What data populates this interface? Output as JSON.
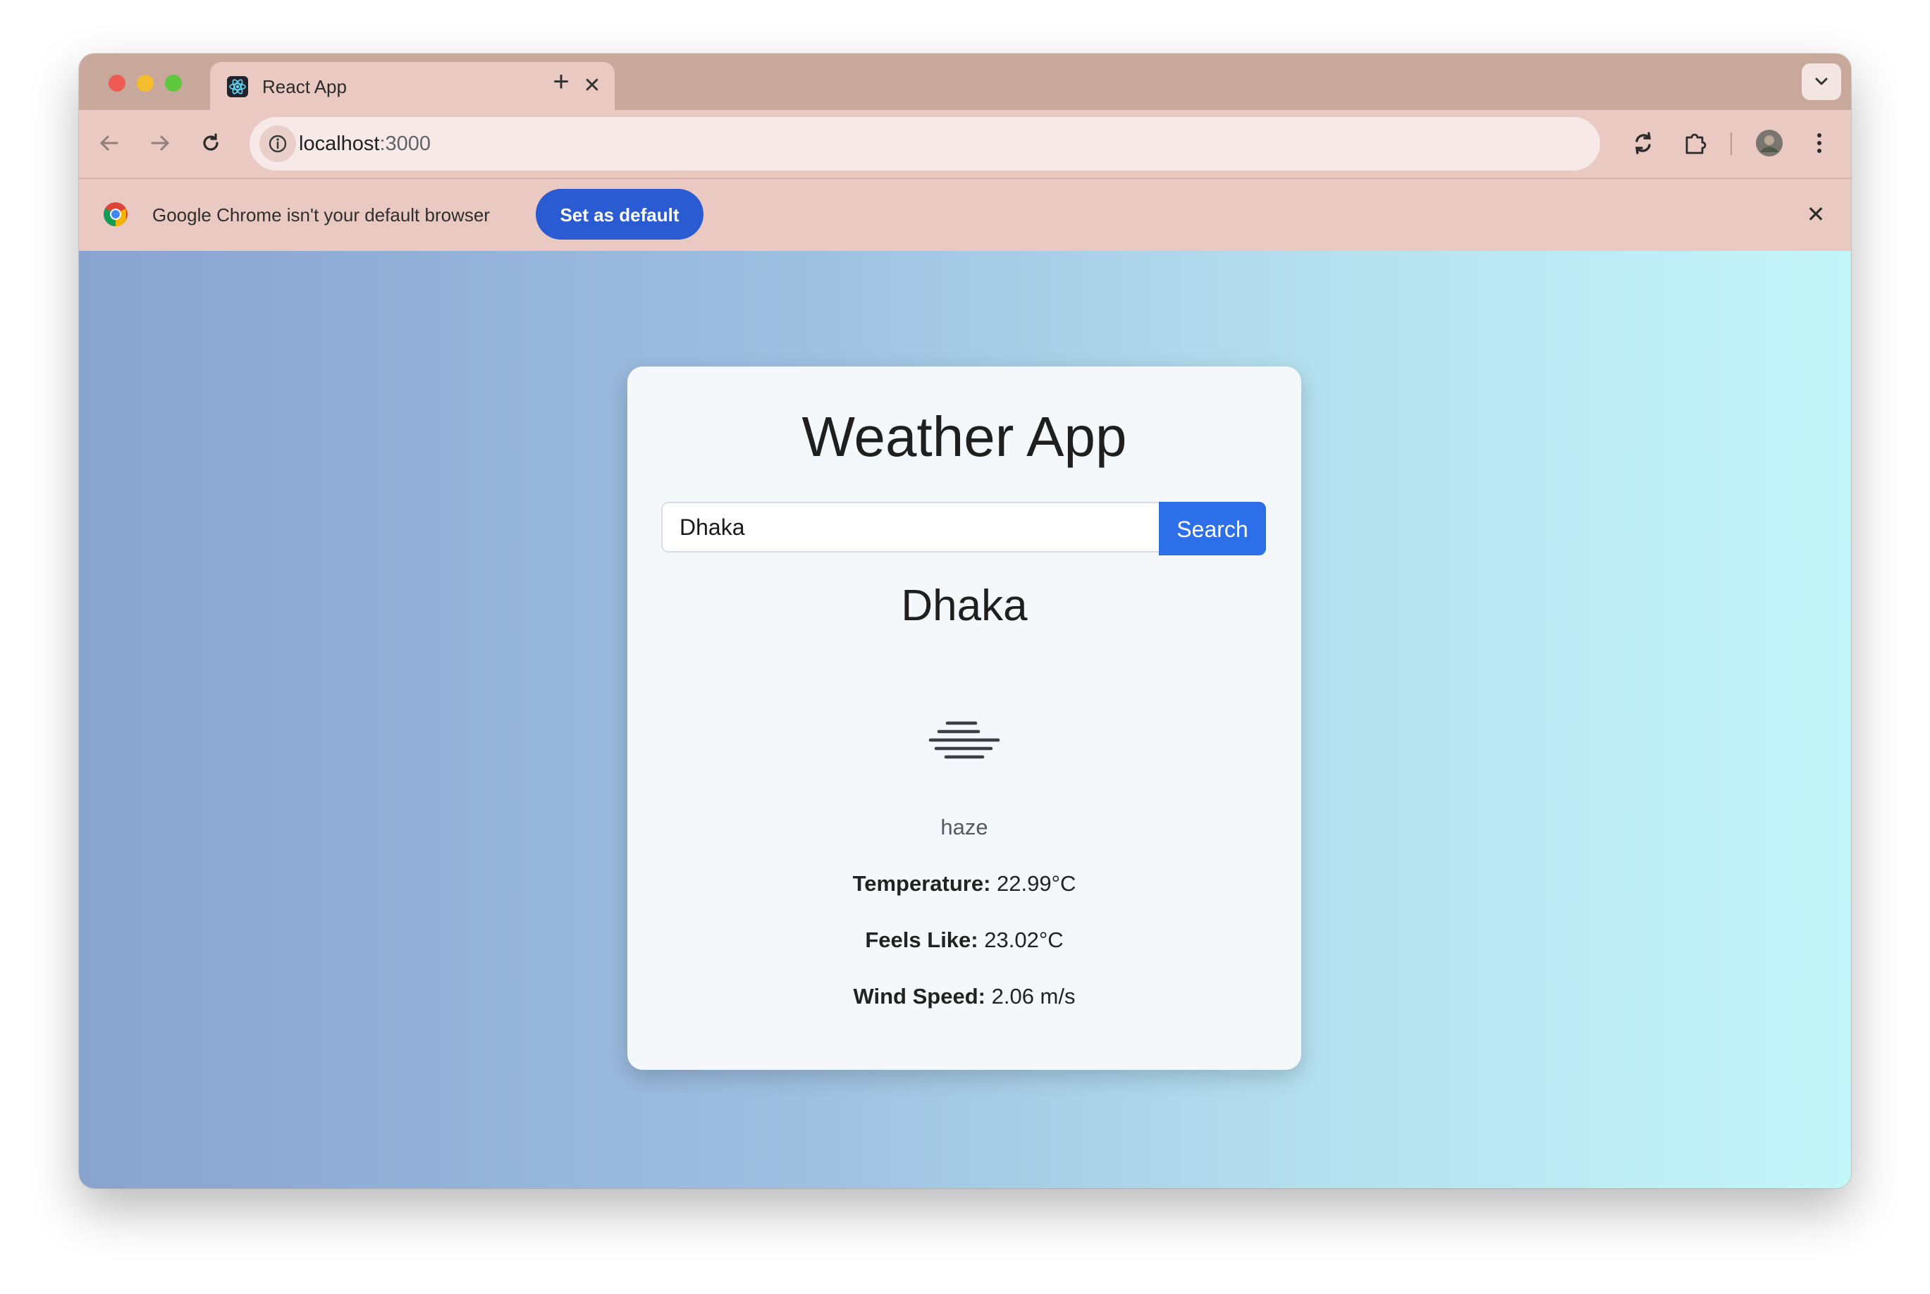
{
  "browser": {
    "tab_title": "React App",
    "url_host": "localhost",
    "url_port": ":3000",
    "infobar_text": "Google Chrome isn't your default browser",
    "set_default_label": "Set as default"
  },
  "app": {
    "title": "Weather App",
    "search_value": "Dhaka",
    "search_button_label": "Search",
    "city": "Dhaka",
    "condition": "haze",
    "condition_icon": "haze-icon",
    "temperature_label": "Temperature:",
    "temperature_value": "22.99°C",
    "feels_like_label": "Feels Like:",
    "feels_like_value": "23.02°C",
    "wind_speed_label": "Wind Speed:",
    "wind_speed_value": "2.06 m/s"
  },
  "colors": {
    "search_button": "#2d6ee9",
    "set_default_button": "#2a5bd3",
    "gradient_start": "#89a3cf",
    "gradient_end": "#c3f6f9"
  }
}
